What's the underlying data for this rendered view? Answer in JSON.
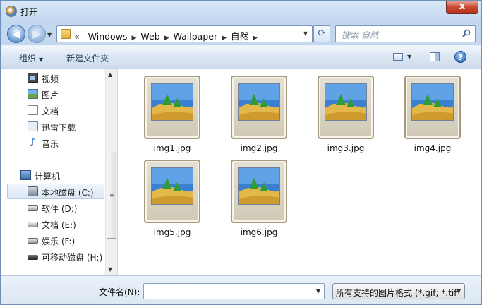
{
  "window": {
    "title": "打开",
    "close_label": "x"
  },
  "nav": {
    "back_label": "◀",
    "forward_label": "▶",
    "breadcrumb_prefix": "«",
    "breadcrumbs": [
      "Windows",
      "Web",
      "Wallpaper",
      "自然"
    ],
    "search_placeholder": "搜索 自然"
  },
  "toolbar": {
    "organize_label": "组织",
    "new_folder_label": "新建文件夹"
  },
  "sidebar": {
    "libraries": [
      {
        "label": "视频",
        "icon": "video-icon"
      },
      {
        "label": "图片",
        "icon": "pictures-icon"
      },
      {
        "label": "文档",
        "icon": "documents-icon"
      },
      {
        "label": "迅雷下载",
        "icon": "downloads-icon"
      },
      {
        "label": "音乐",
        "icon": "music-icon"
      }
    ],
    "computer_label": "计算机",
    "drives": [
      {
        "label": "本地磁盘 (C:)",
        "icon": "system-drive-icon",
        "selected": true
      },
      {
        "label": "软件 (D:)",
        "icon": "drive-icon"
      },
      {
        "label": "文档 (E:)",
        "icon": "drive-icon"
      },
      {
        "label": "娱乐 (F:)",
        "icon": "drive-icon"
      },
      {
        "label": "可移动磁盘 (H:)",
        "icon": "removable-drive-icon"
      }
    ]
  },
  "files": [
    {
      "name": "img1.jpg"
    },
    {
      "name": "img2.jpg"
    },
    {
      "name": "img3.jpg"
    },
    {
      "name": "img4.jpg"
    },
    {
      "name": "img5.jpg"
    },
    {
      "name": "img6.jpg"
    }
  ],
  "footer": {
    "filename_label": "文件名(N):",
    "filename_value": "",
    "filter_value": "所有支持的图片格式 (*.gif; *.tif"
  },
  "colors": {
    "accent": "#3d6ea8",
    "close": "#c94a33",
    "selection": "#dbe7f4"
  }
}
